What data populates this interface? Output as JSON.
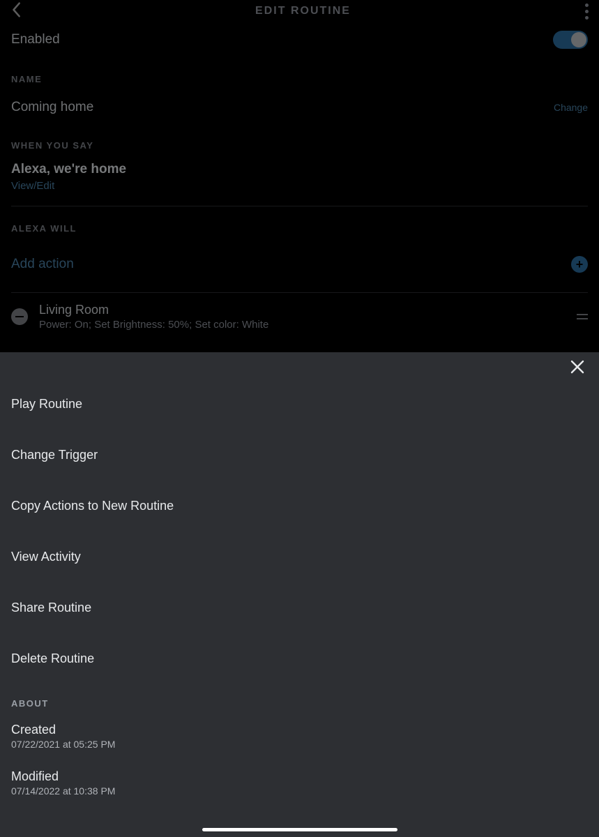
{
  "header": {
    "title": "EDIT ROUTINE"
  },
  "enabled": {
    "label": "Enabled",
    "value": true
  },
  "name_section": {
    "label": "NAME",
    "value": "Coming home",
    "change": "Change"
  },
  "trigger_section": {
    "label": "WHEN YOU SAY",
    "phrase": "Alexa, we're home",
    "edit": "View/Edit"
  },
  "actions_section": {
    "label": "ALEXA WILL",
    "add": "Add action",
    "items": [
      {
        "title": "Living Room",
        "desc": "Power: On; Set Brightness: 50%; Set color: White"
      }
    ]
  },
  "sheet": {
    "menu": [
      "Play Routine",
      "Change Trigger",
      "Copy Actions to New Routine",
      "View Activity",
      "Share Routine",
      "Delete Routine"
    ],
    "about_label": "ABOUT",
    "about": [
      {
        "t": "Created",
        "s": "07/22/2021 at 05:25 PM"
      },
      {
        "t": "Modified",
        "s": "07/14/2022 at 10:38 PM"
      }
    ]
  }
}
